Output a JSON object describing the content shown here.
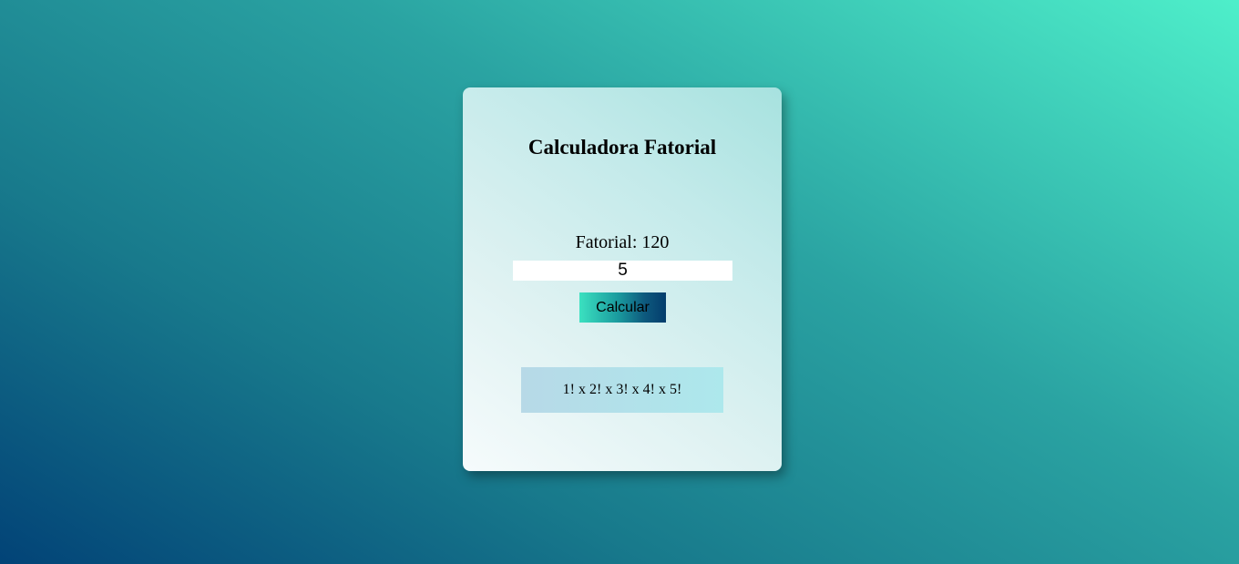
{
  "app": {
    "title": "Calculadora Fatorial"
  },
  "result": {
    "label": "Fatorial: 120"
  },
  "input": {
    "value": "5"
  },
  "button": {
    "label": "Calcular"
  },
  "expansion": {
    "text": "1! x 2! x 3! x 4! x 5!"
  },
  "colors": {
    "background_start": "#024377",
    "background_end": "#4eefca",
    "button_start": "#3be1c0",
    "button_end": "#033c6c",
    "expansion_box": "#b7d9e7"
  }
}
